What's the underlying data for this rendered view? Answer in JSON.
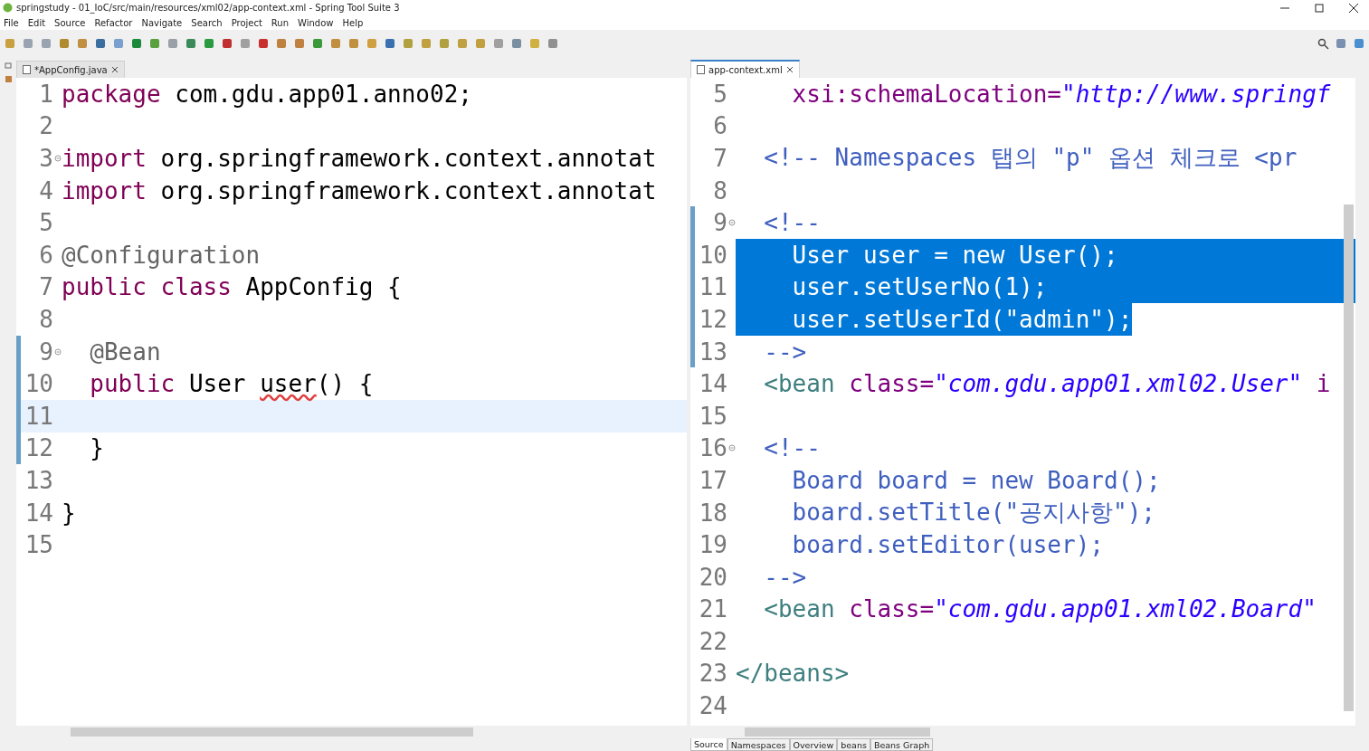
{
  "window": {
    "title": "springstudy - 01_IoC/src/main/resources/xml02/app-context.xml - Spring Tool Suite 3"
  },
  "menu": [
    "File",
    "Edit",
    "Source",
    "Refactor",
    "Navigate",
    "Search",
    "Project",
    "Run",
    "Window",
    "Help"
  ],
  "editors": [
    {
      "tab": {
        "label": "*AppConfig.java",
        "selected": false
      },
      "lines": [
        {
          "num": "1",
          "tokens": [
            {
              "kind": "keyword",
              "text": "package"
            },
            {
              "kind": "plain",
              "text": " com.gdu.app01.anno02;"
            }
          ]
        },
        {
          "num": "2"
        },
        {
          "num": "3",
          "fold": true,
          "tokens": [
            {
              "kind": "keyword",
              "text": "import"
            },
            {
              "kind": "plain",
              "text": " org.springframework.context.annotat"
            }
          ]
        },
        {
          "num": "4",
          "tokens": [
            {
              "kind": "keyword",
              "text": "import"
            },
            {
              "kind": "plain",
              "text": " org.springframework.context.annotat"
            }
          ]
        },
        {
          "num": "5"
        },
        {
          "num": "6",
          "tokens": [
            {
              "kind": "annotation",
              "text": "@Configuration"
            }
          ]
        },
        {
          "num": "7",
          "tokens": [
            {
              "kind": "keyword",
              "text": "public class"
            },
            {
              "kind": "plain",
              "text": " AppConfig {"
            }
          ]
        },
        {
          "num": "8"
        },
        {
          "num": "9",
          "fold": true,
          "changed": true,
          "tokens": [
            {
              "kind": "annotation",
              "text": "  @Bean"
            }
          ]
        },
        {
          "num": "10",
          "changed": true,
          "tokens": [
            {
              "kind": "keyword",
              "text": "  public"
            },
            {
              "kind": "plain",
              "text": " User "
            },
            {
              "kind": "warning",
              "text": "user"
            },
            {
              "kind": "plain",
              "text": "() {"
            }
          ]
        },
        {
          "num": "11",
          "changed": true,
          "current": true
        },
        {
          "num": "12",
          "changed": true,
          "tokens": [
            {
              "kind": "plain",
              "text": "  }"
            }
          ]
        },
        {
          "num": "13"
        },
        {
          "num": "14",
          "tokens": [
            {
              "kind": "plain",
              "text": "}"
            }
          ]
        },
        {
          "num": "15"
        }
      ]
    },
    {
      "tab": {
        "label": "app-context.xml",
        "selected": true
      },
      "lines": [
        {
          "num": "5",
          "tokens": [
            {
              "kind": "attr",
              "text": "    xsi:schemaLocation="
            },
            {
              "kind": "string",
              "text": "\"http://www.springf"
            }
          ]
        },
        {
          "num": "6"
        },
        {
          "num": "7",
          "tokens": [
            {
              "kind": "comment",
              "text": "  <!-- Namespaces 탭의 \"p\" 옵션 체크로 <pr"
            }
          ]
        },
        {
          "num": "8"
        },
        {
          "num": "9",
          "fold": true,
          "changed": true,
          "tokens": [
            {
              "kind": "comment",
              "text": "  <!--"
            }
          ]
        },
        {
          "num": "10",
          "changed": true,
          "selected": true,
          "to_line_end": true,
          "tokens": [
            {
              "kind": "comment",
              "text": "    User user = new User();"
            }
          ]
        },
        {
          "num": "11",
          "changed": true,
          "selected": true,
          "to_line_end": true,
          "tokens": [
            {
              "kind": "comment",
              "text": "    user.setUserNo(1);"
            }
          ]
        },
        {
          "num": "12",
          "changed": true,
          "selected": true,
          "to_line_end": false,
          "tokens": [
            {
              "kind": "comment",
              "text": "    user.setUserId(\"admin\");"
            }
          ]
        },
        {
          "num": "13",
          "changed": true,
          "tokens": [
            {
              "kind": "comment",
              "text": "  -->"
            }
          ]
        },
        {
          "num": "14",
          "tokens": [
            {
              "kind": "tag",
              "text": "  <bean "
            },
            {
              "kind": "attr",
              "text": "class="
            },
            {
              "kind": "string",
              "text": "\"com.gdu.app01.xml02.User\" "
            },
            {
              "kind": "attr",
              "text": "i"
            }
          ]
        },
        {
          "num": "15"
        },
        {
          "num": "16",
          "fold": true,
          "tokens": [
            {
              "kind": "comment",
              "text": "  <!--"
            }
          ]
        },
        {
          "num": "17",
          "tokens": [
            {
              "kind": "comment",
              "text": "    Board board = new Board();"
            }
          ]
        },
        {
          "num": "18",
          "tokens": [
            {
              "kind": "comment",
              "text": "    board.setTitle(\"공지사항\");"
            }
          ]
        },
        {
          "num": "19",
          "tokens": [
            {
              "kind": "comment",
              "text": "    board.setEditor(user);"
            }
          ]
        },
        {
          "num": "20",
          "tokens": [
            {
              "kind": "comment",
              "text": "  -->"
            }
          ]
        },
        {
          "num": "21",
          "tokens": [
            {
              "kind": "tag",
              "text": "  <bean "
            },
            {
              "kind": "attr",
              "text": "class="
            },
            {
              "kind": "string",
              "text": "\"com.gdu.app01.xml02.Board\""
            }
          ]
        },
        {
          "num": "22"
        },
        {
          "num": "23",
          "tokens": [
            {
              "kind": "tag",
              "text": "</beans>"
            }
          ]
        },
        {
          "num": "24"
        }
      ],
      "bottom_tabs": [
        {
          "label": "Source",
          "selected": true
        },
        {
          "label": "Namespaces",
          "selected": false
        },
        {
          "label": "Overview",
          "selected": false
        },
        {
          "label": "beans",
          "selected": false
        },
        {
          "label": "Beans Graph",
          "selected": false
        }
      ]
    }
  ]
}
